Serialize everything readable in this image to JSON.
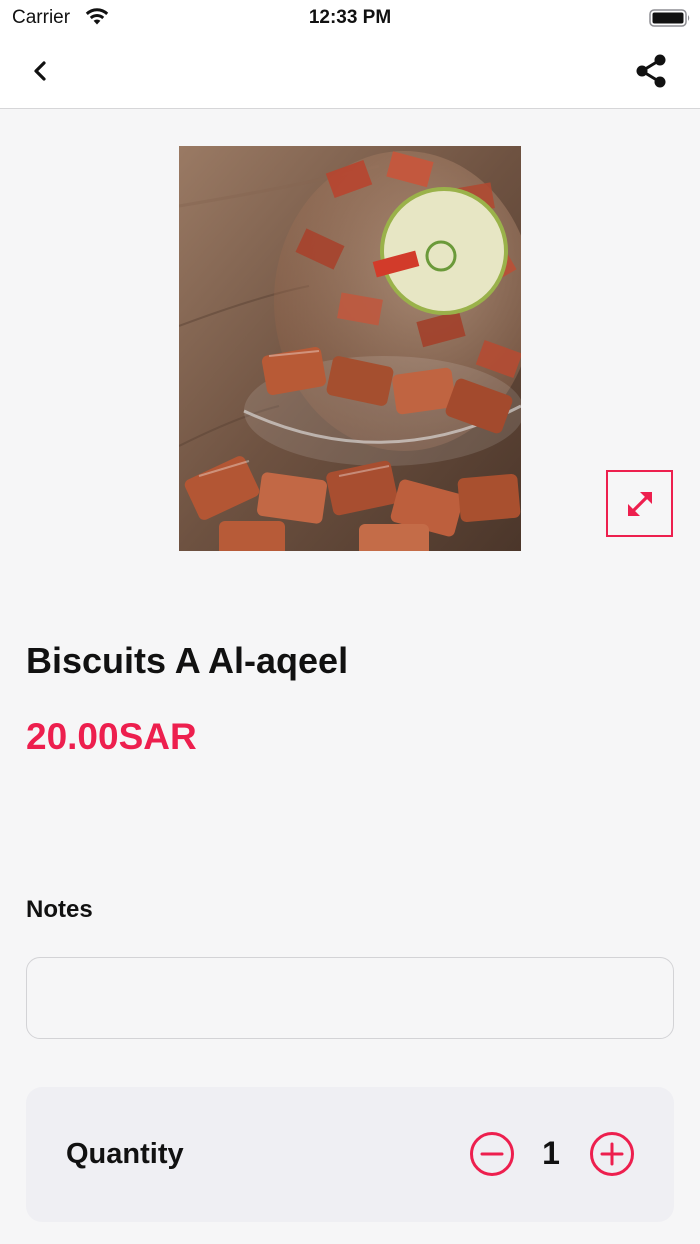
{
  "status_bar": {
    "carrier": "Carrier",
    "time": "12:33 PM",
    "icons": [
      "wifi-icon",
      "battery-icon"
    ]
  },
  "nav": {
    "icons": [
      "back-icon",
      "share-icon"
    ]
  },
  "product": {
    "image_alt": "product photo",
    "title": "Biscuits A Al-aqeel",
    "price": "20.00SAR",
    "expand_icon": "expand-arrows-icon"
  },
  "notes": {
    "label": "Notes",
    "value": "",
    "placeholder": ""
  },
  "quantity": {
    "label": "Quantity",
    "value": "1",
    "icons": [
      "minus-circle-icon",
      "plus-circle-icon"
    ]
  },
  "colors": {
    "accent": "#ed1f4e",
    "background": "#f6f6f7",
    "card": "#efeff3"
  }
}
